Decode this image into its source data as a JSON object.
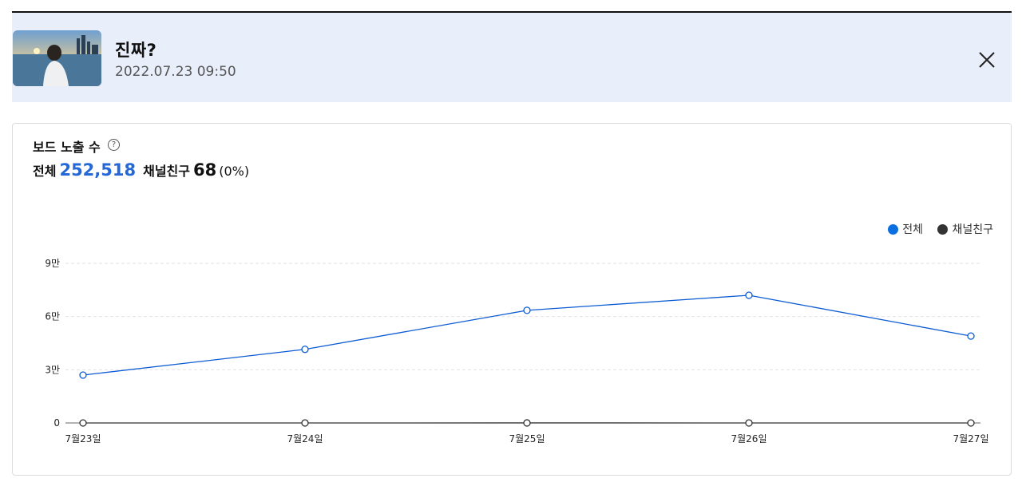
{
  "post": {
    "title": "진짜?",
    "date": "2022.07.23 09:50"
  },
  "metric": {
    "title": "보드 노출 수",
    "help_icon": "?",
    "total_label": "전체",
    "total_value": "252,518",
    "friend_label": "채널친구",
    "friend_value": "68",
    "friend_pct": "(0%)"
  },
  "colors": {
    "accent": "#2467d6",
    "friend": "#333333",
    "header_bg": "#e9eefb"
  },
  "chart_data": {
    "type": "line",
    "categories": [
      "7월23일",
      "7월24일",
      "7월25일",
      "7월26일",
      "7월27일"
    ],
    "y_ticks": [
      {
        "value": 0,
        "label": "0"
      },
      {
        "value": 30000,
        "label": "3만"
      },
      {
        "value": 60000,
        "label": "6만"
      },
      {
        "value": 90000,
        "label": "9만"
      }
    ],
    "ylim": [
      0,
      90000
    ],
    "grid": true,
    "legend_placement": "top-right",
    "series": [
      {
        "name": "전체",
        "color": "#0b5bd3",
        "values": [
          27000,
          41500,
          63500,
          72000,
          49000
        ]
      },
      {
        "name": "채널친구",
        "color": "#333333",
        "values": [
          10,
          15,
          18,
          15,
          10
        ]
      }
    ]
  }
}
